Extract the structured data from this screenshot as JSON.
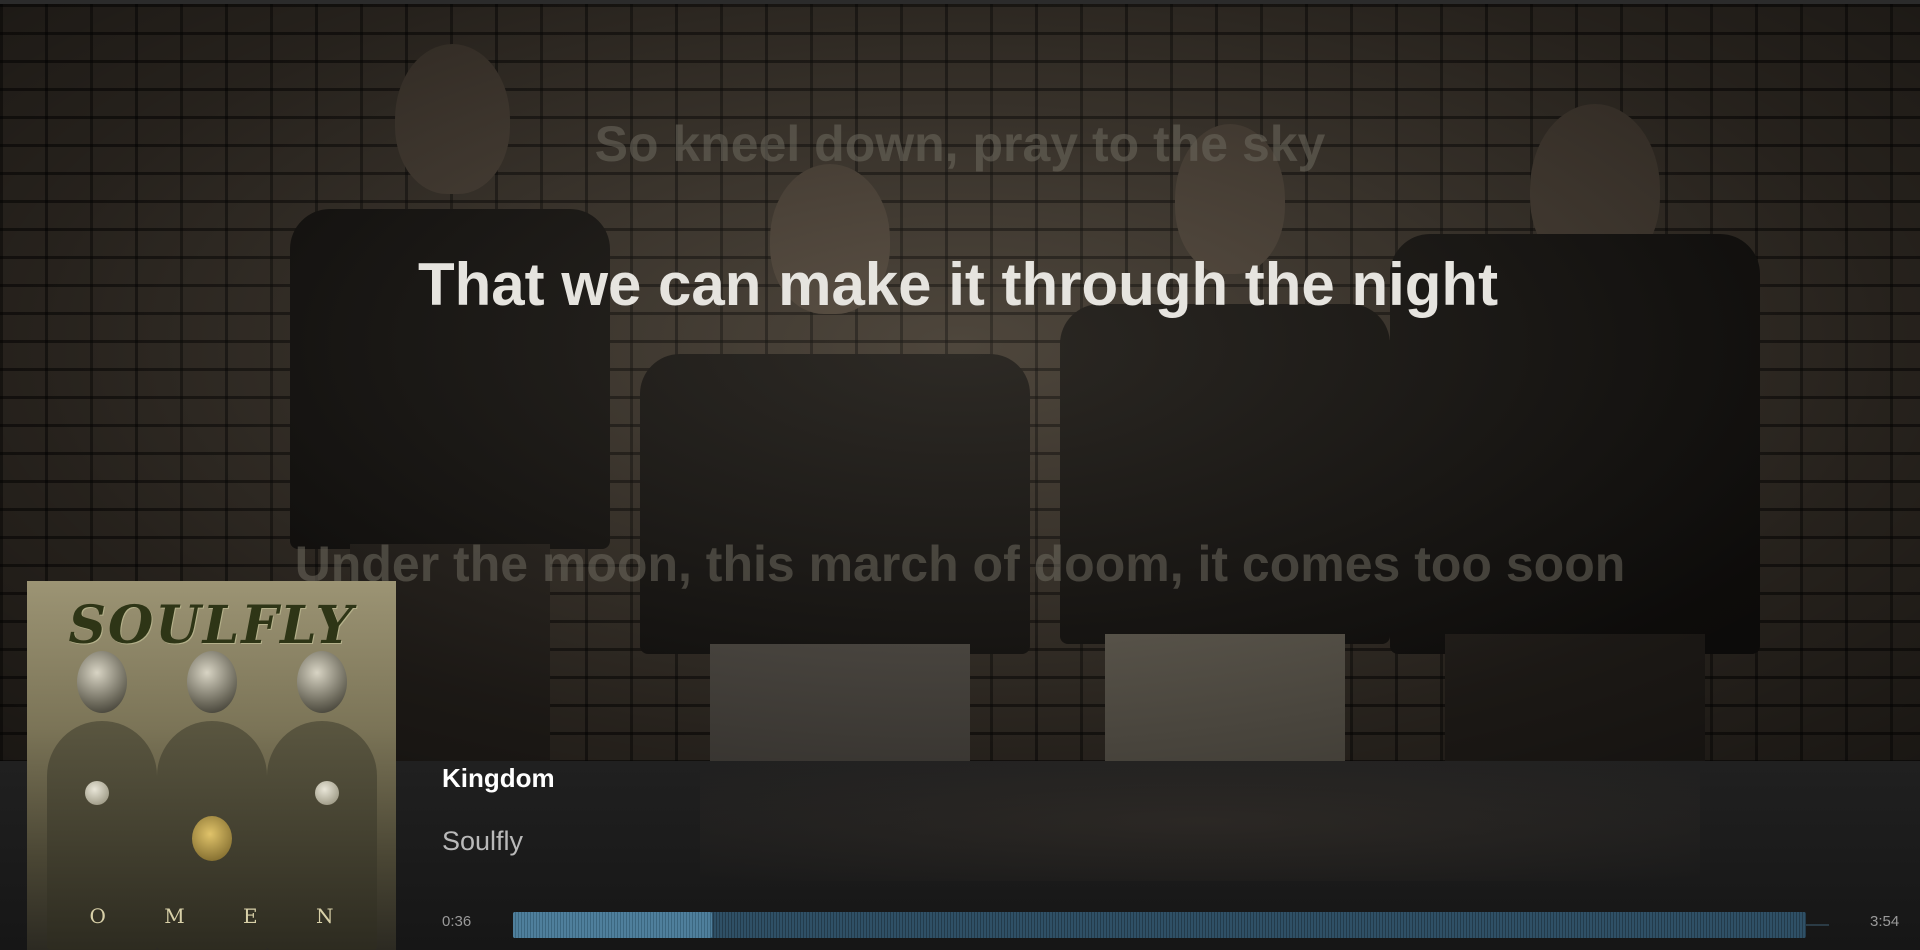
{
  "lyrics": {
    "previous": "So kneel down, pray to the sky",
    "current": "That we can make it through the night",
    "next": "Under the moon, this march of doom, it comes too soon"
  },
  "track": {
    "title": "Kingdom",
    "artist": "Soulfly"
  },
  "album": {
    "logo_text": "SOULFLY",
    "title_text": "O M E N"
  },
  "playback": {
    "elapsed": "0:36",
    "total": "3:54",
    "progress_fraction": 0.154
  },
  "colors": {
    "progress_played": "#4f7f9c",
    "progress_unplayed": "#2f5066",
    "lyric_current": "#e6e4df"
  }
}
